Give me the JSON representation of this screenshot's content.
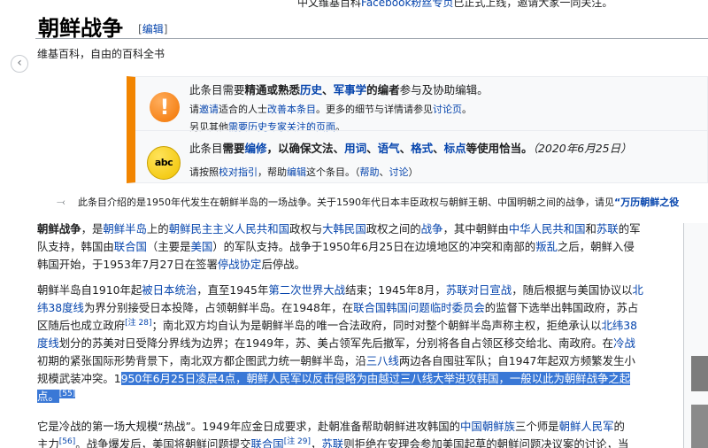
{
  "top_notice": {
    "pre": "中文维基百科",
    "link": "Facebook粉丝专页",
    "post": "已正式上线，邀请大家一同关注。"
  },
  "back_icon": "chevron-left-icon",
  "title": "朝鲜战争",
  "edit": {
    "open": "[",
    "label": "编辑",
    "close": "]"
  },
  "site_sub": "维基百科，自由的百科全书",
  "amboxes": [
    {
      "icon": "exclamation-icon",
      "line1": {
        "a": "此条目需要",
        "b1": "精通或熟悉",
        "l1": "历史",
        "s1": "、",
        "l2": "军事学",
        "b2": "的编者",
        "c": "参与及协助编辑。"
      },
      "line2": {
        "a": "请",
        "l1": "邀请",
        "b": "适合的人士",
        "l2": "改善本条目",
        "c": "。更多的细节与详情请参见",
        "l3": "讨论页",
        "d": "。"
      },
      "line3": {
        "a": "另见其他",
        "l1": "需要历史专家关注的页面",
        "b": "。"
      }
    },
    {
      "icon_text": "abc",
      "line1": {
        "a": "此条目",
        "b1": "需要",
        "l1": "编修",
        "b2": "，以确保文法、",
        "l2": "用词",
        "s1": "、",
        "l3": "语气",
        "s2": "、",
        "l4": "格式",
        "s3": "、",
        "l5": "标点",
        "b3": "等使用恰当。",
        "date": "（2020年6月25日）"
      },
      "line2": {
        "a": "请按照",
        "l1": "校对指引",
        "b": "，帮助",
        "l2": "编辑",
        "c": "这个条目。（",
        "l3": "帮助",
        "s": "、",
        "l4": "讨论",
        "d": "）"
      }
    }
  ],
  "hatnote": {
    "icon": "disambiguation-arrow-icon",
    "text": "此条目介绍的是1950年代发生在朝鲜半岛的一场战争。关于1590年代日本丰臣政权与朝鲜王朝、中国明朝之间的战争，请见",
    "link": "“万历朝鲜之役"
  },
  "p1": [
    [
      {
        "t": "朝鲜战争",
        "b": true
      },
      {
        "t": "，是"
      },
      {
        "t": "朝鲜半岛",
        "l": true
      },
      {
        "t": "上的"
      },
      {
        "t": "朝鲜民主主义人民共和国",
        "l": true
      },
      {
        "t": "政权与"
      },
      {
        "t": "大韩民国",
        "l": true
      },
      {
        "t": "政权之间的"
      },
      {
        "t": "战争",
        "l": true
      },
      {
        "t": "，其中朝鲜由"
      },
      {
        "t": "中华人民共和国",
        "l": true
      },
      {
        "t": "和"
      },
      {
        "t": "苏联",
        "l": true
      },
      {
        "t": "的军"
      }
    ],
    [
      {
        "t": "队支持，韩国由"
      },
      {
        "t": "联合国",
        "l": true
      },
      {
        "t": "（主要是"
      },
      {
        "t": "美国",
        "l": true
      },
      {
        "t": "）的军队支持。战争于1950年6月25日在边境地区的冲突和南部的"
      },
      {
        "t": "叛乱",
        "l": true
      },
      {
        "t": "之后，朝鲜入侵"
      }
    ],
    [
      {
        "t": "韩国开始，于1953年7月27日在签署"
      },
      {
        "t": "停战协定",
        "l": true
      },
      {
        "t": "后停战。"
      }
    ]
  ],
  "p2": [
    [
      {
        "t": "朝鲜半岛自1910年起"
      },
      {
        "t": "被日本统治",
        "l": true
      },
      {
        "t": "，直至1945年"
      },
      {
        "t": "第二次世界大战",
        "l": true
      },
      {
        "t": "结束；1945年8月，"
      },
      {
        "t": "苏联对日宣战",
        "l": true
      },
      {
        "t": "，随后根据与美国协议以"
      },
      {
        "t": "北",
        "l": true
      }
    ],
    [
      {
        "t": "纬38度线",
        "l": true
      },
      {
        "t": "为界分别接受日本投降，占领朝鲜半岛。在1948年，在"
      },
      {
        "t": "联合国韩国问题临时委员会",
        "l": true
      },
      {
        "t": "的监督下选举出韩国政府，苏占"
      }
    ],
    [
      {
        "t": "区随后也成立政府"
      },
      {
        "t": "[注 28]",
        "l": true,
        "sup": true
      },
      {
        "t": "；南北双方均自认为是朝鲜半岛的唯一合法政府，同时对整个朝鲜半岛声称主权，拒绝承认以"
      },
      {
        "t": "北纬38",
        "l": true
      }
    ],
    [
      {
        "t": "度线",
        "l": true
      },
      {
        "t": "划分的苏美对日受降分界线为边界；在1949年，苏、美占领军先后撤军，分别将各自占领区移交给北、南政府。在"
      },
      {
        "t": "冷战",
        "l": true
      }
    ],
    [
      {
        "t": "初期的紧张国际形势背景下，南北双方都企图武力统一朝鲜半岛，沿"
      },
      {
        "t": "三八线",
        "l": true
      },
      {
        "t": "两边各自囤驻军队；自1947年起双方频繁发生小"
      }
    ],
    [
      {
        "t": "规模武装冲突。1"
      },
      {
        "t": "950年6月25日凌晨4点，朝鲜人民军以反击侵略为由越过三八线大举进攻韩国，一般以此为朝鲜战争之起",
        "h": true
      }
    ],
    [
      {
        "t": "点。",
        "h": true
      },
      {
        "t": "[55]",
        "l": true,
        "sup": true,
        "h": true
      }
    ]
  ],
  "p3": [
    [
      {
        "t": "它是冷战的第一场大规模“热战”。1949年应金日成要求，赴朝准备帮助朝鲜进攻韩国的"
      },
      {
        "t": "中国朝鲜族",
        "l": true
      },
      {
        "t": "三个师是"
      },
      {
        "t": "朝鲜人民军",
        "l": true
      },
      {
        "t": "的"
      }
    ],
    [
      {
        "t": "主力"
      },
      {
        "t": "[56]",
        "l": true,
        "sup": true
      },
      {
        "t": "。战争爆发后，美国将朝鲜问题提交"
      },
      {
        "t": "联合国",
        "l": true
      },
      {
        "t": "[注 29]",
        "l": true,
        "sup": true
      },
      {
        "t": "，"
      },
      {
        "t": "苏联",
        "l": true
      },
      {
        "t": "则拒绝在安理会参加美国起草的朝鲜问题决议案的讨论，当"
      }
    ]
  ]
}
